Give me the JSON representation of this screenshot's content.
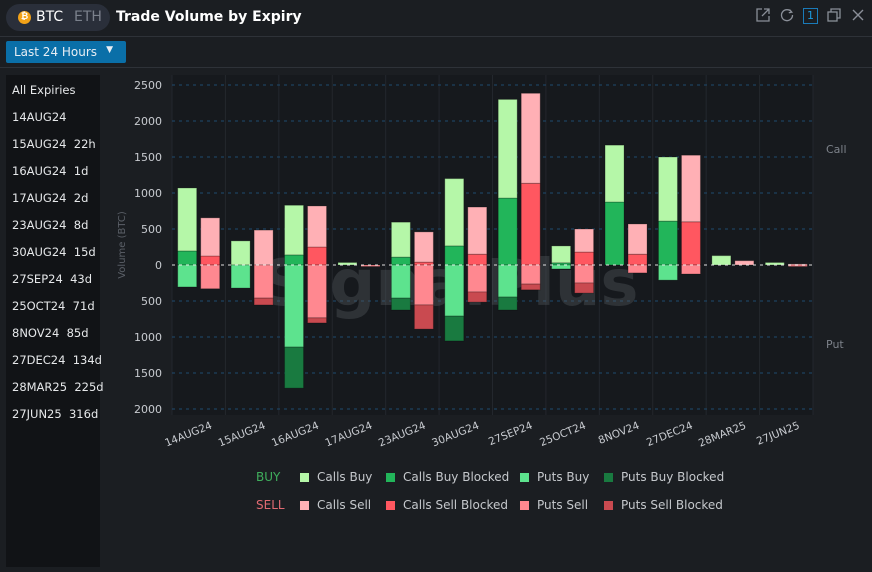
{
  "header": {
    "coins": [
      "BTC",
      "ETH"
    ],
    "selected_coin": "BTC",
    "coin_icon": "₿",
    "title": "Trade Volume by Expiry",
    "icons": [
      "external-link-icon",
      "refresh-icon",
      "number-one-icon",
      "copy-window-icon",
      "close-icon"
    ],
    "active_number": "1"
  },
  "filter": {
    "range_label": "Last 24 Hours",
    "caret": "▼"
  },
  "sidebar": {
    "items": [
      {
        "label": "All Expiries"
      },
      {
        "label": "14AUG24"
      },
      {
        "label": "15AUG24  22h"
      },
      {
        "label": "16AUG24  1d"
      },
      {
        "label": "17AUG24  2d"
      },
      {
        "label": "23AUG24  8d"
      },
      {
        "label": "30AUG24  15d"
      },
      {
        "label": "27SEP24  43d"
      },
      {
        "label": "25OCT24  71d"
      },
      {
        "label": "8NOV24  85d"
      },
      {
        "label": "27DEC24  134d"
      },
      {
        "label": "28MAR25  225d"
      },
      {
        "label": "27JUN25  316d"
      }
    ]
  },
  "side_labels": {
    "call": "Call",
    "put": "Put"
  },
  "watermark": "SignalPlus",
  "legend": {
    "buy_label": "BUY",
    "sell_label": "SELL",
    "buy_color": "#3fae5c",
    "sell_color": "#e06a72",
    "buy_items": [
      {
        "label": "Calls Buy",
        "color": "#b5f7a8"
      },
      {
        "label": "Calls Buy Blocked",
        "color": "#22b55a"
      },
      {
        "label": "Puts Buy",
        "color": "#5de38e"
      },
      {
        "label": "Puts Buy Blocked",
        "color": "#197a40"
      }
    ],
    "sell_items": [
      {
        "label": "Calls Sell",
        "color": "#ffb0b5"
      },
      {
        "label": "Calls Sell Blocked",
        "color": "#ff5760"
      },
      {
        "label": "Puts Sell",
        "color": "#ff8890"
      },
      {
        "label": "Puts Sell Blocked",
        "color": "#c94a50"
      }
    ]
  },
  "chart_data": {
    "type": "bar",
    "stacked": true,
    "title": "Trade Volume by Expiry",
    "xlabel": "",
    "ylabel": "Volume (BTC)",
    "ylim": [
      -2000,
      2500
    ],
    "yticks": [
      2500,
      2000,
      1500,
      1000,
      500,
      0,
      500,
      1000,
      1500,
      2000
    ],
    "ytick_values": [
      2500,
      2000,
      1500,
      1000,
      500,
      0,
      -500,
      -1000,
      -1500,
      -2000
    ],
    "grid": true,
    "legend_position": "bottom",
    "categories": [
      "14AUG24",
      "15AUG24",
      "16AUG24",
      "17AUG24",
      "23AUG24",
      "30AUG24",
      "27SEP24",
      "25OCT24",
      "8NOV24",
      "27DEC24",
      "28MAR25",
      "27JUN25"
    ],
    "series": [
      {
        "name": "Calls Buy",
        "side": "buy",
        "values": [
          875,
          335,
          690,
          35,
          485,
          935,
          1370,
          235,
          790,
          890,
          130,
          35
        ]
      },
      {
        "name": "Calls Buy Blocked",
        "side": "buy",
        "values": [
          195,
          0,
          140,
          0,
          110,
          265,
          930,
          30,
          875,
          610,
          0,
          0
        ]
      },
      {
        "name": "Puts Buy",
        "side": "buy",
        "values": [
          -305,
          -320,
          -1140,
          0,
          -460,
          -710,
          -445,
          -55,
          0,
          -210,
          0,
          0
        ]
      },
      {
        "name": "Puts Buy Blocked",
        "side": "buy",
        "values": [
          0,
          0,
          -570,
          0,
          -165,
          -345,
          -180,
          0,
          0,
          0,
          0,
          0
        ]
      },
      {
        "name": "Calls Sell",
        "side": "sell",
        "values": [
          530,
          485,
          570,
          0,
          420,
          655,
          1250,
          320,
          420,
          925,
          60,
          15
        ]
      },
      {
        "name": "Calls Sell Blocked",
        "side": "sell",
        "values": [
          125,
          0,
          250,
          0,
          40,
          150,
          1135,
          180,
          150,
          600,
          0,
          0
        ]
      },
      {
        "name": "Puts Sell",
        "side": "sell",
        "values": [
          -330,
          -460,
          -735,
          -15,
          -555,
          -375,
          -265,
          -250,
          -110,
          -125,
          0,
          -5
        ]
      },
      {
        "name": "Puts Sell Blocked",
        "side": "sell",
        "values": [
          0,
          -95,
          -70,
          0,
          -335,
          -140,
          -80,
          -140,
          0,
          0,
          0,
          0
        ]
      }
    ]
  }
}
